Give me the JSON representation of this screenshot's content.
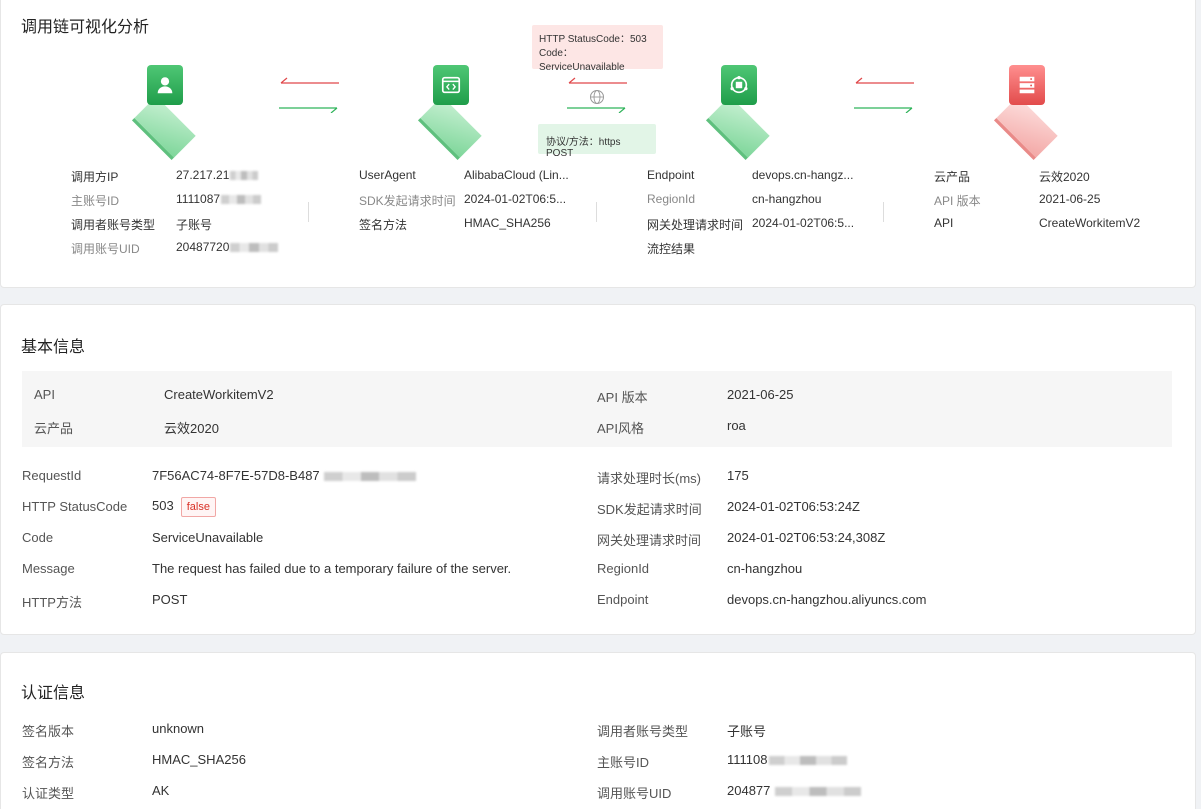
{
  "chain": {
    "title": "调用链可视化分析",
    "error_tip_line1": "HTTP StatusCode：503",
    "error_tip_line2": "Code：ServiceUnavailable",
    "protocol_tip": "协议/方法：https POST",
    "nodes": [
      {
        "icon": "user-icon",
        "color": "green"
      },
      {
        "icon": "code-window-icon",
        "color": "green"
      },
      {
        "icon": "gateway-hub-icon",
        "color": "green"
      },
      {
        "icon": "server-stack-icon",
        "color": "red"
      }
    ],
    "col1": [
      {
        "k": "调用方IP",
        "v": "27.217.21"
      },
      {
        "k": "主账号ID",
        "v": "1111087"
      },
      {
        "k": "调用者账号类型",
        "v": "子账号"
      },
      {
        "k": "调用账号UID",
        "v": "20487720"
      }
    ],
    "col2": [
      {
        "k": "UserAgent",
        "v": "AlibabaCloud (Lin..."
      },
      {
        "k": "SDK发起请求时间",
        "v": "2024-01-02T06:5..."
      },
      {
        "k": "签名方法",
        "v": "HMAC_SHA256"
      }
    ],
    "col3": [
      {
        "k": "Endpoint",
        "v": "devops.cn-hangz..."
      },
      {
        "k": "RegionId",
        "v": "cn-hangzhou"
      },
      {
        "k": "网关处理请求时间",
        "v": "2024-01-02T06:5..."
      },
      {
        "k": "流控结果",
        "v": ""
      }
    ],
    "col4": [
      {
        "k": "云产品",
        "v": "云效2020"
      },
      {
        "k": "API 版本",
        "v": "2021-06-25"
      },
      {
        "k": "API",
        "v": "CreateWorkitemV2"
      }
    ]
  },
  "basic": {
    "title": "基本信息",
    "api_label": "API",
    "api_value": "CreateWorkitemV2",
    "product_label": "云产品",
    "product_value": "云效2020",
    "version_label": "API 版本",
    "version_value": "2021-06-25",
    "style_label": "API风格",
    "style_value": "roa",
    "rows_left": [
      {
        "k": "RequestId",
        "v": "7F56AC74-8F7E-57D8-B487"
      },
      {
        "k": "HTTP StatusCode",
        "v": "503"
      },
      {
        "k": "Code",
        "v": "ServiceUnavailable"
      },
      {
        "k": "Message",
        "v": "The request has failed due to a temporary failure of the server."
      },
      {
        "k": "HTTP方法",
        "v": "POST"
      }
    ],
    "status_tag": "false",
    "rows_right": [
      {
        "k": "请求处理时长(ms)",
        "v": "175"
      },
      {
        "k": "SDK发起请求时间",
        "v": "2024-01-02T06:53:24Z"
      },
      {
        "k": "网关处理请求时间",
        "v": "2024-01-02T06:53:24,308Z"
      },
      {
        "k": "RegionId",
        "v": "cn-hangzhou"
      },
      {
        "k": "Endpoint",
        "v": "devops.cn-hangzhou.aliyuncs.com"
      }
    ]
  },
  "auth": {
    "title": "认证信息",
    "rows_left": [
      {
        "k": "签名版本",
        "v": "unknown"
      },
      {
        "k": "签名方法",
        "v": "HMAC_SHA256"
      },
      {
        "k": "认证类型",
        "v": "AK"
      }
    ],
    "rows_right": [
      {
        "k": "调用者账号类型",
        "v": "子账号"
      },
      {
        "k": "主账号ID",
        "v": "111108"
      },
      {
        "k": "调用账号UID",
        "v": "204877"
      }
    ]
  }
}
